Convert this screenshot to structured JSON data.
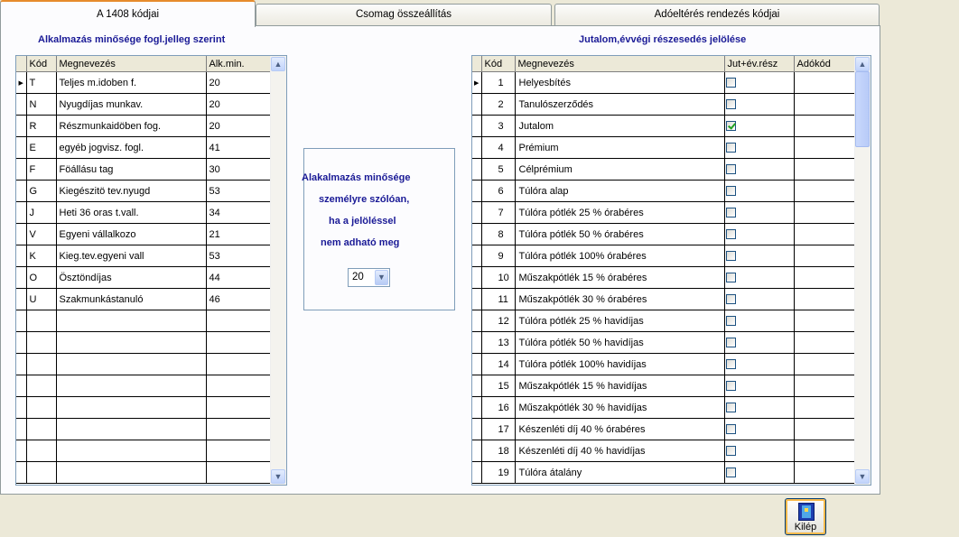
{
  "tabs": [
    {
      "label": "A 1408 kódjai"
    },
    {
      "label": "Csomag összeállítás"
    },
    {
      "label": "Adóeltérés rendezés kódjai"
    }
  ],
  "left": {
    "caption": "Alkalmazás minősége fogl.jelleg szerint",
    "columns": [
      "Kód",
      "Megnevezés",
      "Alk.min."
    ],
    "rows": [
      {
        "kod": "T",
        "name": "Teljes m.idoben f.",
        "alk": "20"
      },
      {
        "kod": "N",
        "name": "Nyugdíjas munkav.",
        "alk": "20"
      },
      {
        "kod": "R",
        "name": "Részmunkaidöben fog.",
        "alk": "20"
      },
      {
        "kod": "E",
        "name": "egyéb jogvisz. fogl.",
        "alk": "41"
      },
      {
        "kod": "F",
        "name": "Föállásu tag",
        "alk": "30"
      },
      {
        "kod": "G",
        "name": "Kiegészitö tev.nyugd",
        "alk": "53"
      },
      {
        "kod": "J",
        "name": "Heti 36 oras t.vall.",
        "alk": "34"
      },
      {
        "kod": "V",
        "name": "Egyeni vállalkozo",
        "alk": "21"
      },
      {
        "kod": "K",
        "name": "Kieg.tev.egyeni vall",
        "alk": "53"
      },
      {
        "kod": "O",
        "name": "Ösztöndíjas",
        "alk": "44"
      },
      {
        "kod": "U",
        "name": "Szakmunkástanuló",
        "alk": "46"
      }
    ]
  },
  "middle": {
    "lines": [
      "Alakalmazás minősége",
      "személyre szólóan,",
      "ha a jelöléssel",
      "nem adható meg"
    ],
    "combo_value": "20"
  },
  "right": {
    "caption": "Jutalom,évvégi részesedés jelölése",
    "columns": [
      "Kód",
      "Megnevezés",
      "Jut+év.rész",
      "Adókód"
    ],
    "rows": [
      {
        "kod": "1",
        "name": "Helyesbítés",
        "checked": false
      },
      {
        "kod": "2",
        "name": "Tanulószerződés",
        "checked": false
      },
      {
        "kod": "3",
        "name": "Jutalom",
        "checked": true
      },
      {
        "kod": "4",
        "name": "Prémium",
        "checked": false
      },
      {
        "kod": "5",
        "name": "Célprémium",
        "checked": false
      },
      {
        "kod": "6",
        "name": "Túlóra alap",
        "checked": false
      },
      {
        "kod": "7",
        "name": "Túlóra pótlék 25 % órabéres",
        "checked": false
      },
      {
        "kod": "8",
        "name": "Túlóra pótlék 50 % órabéres",
        "checked": false
      },
      {
        "kod": "9",
        "name": "Túlóra pótlék  100% órabéres",
        "checked": false
      },
      {
        "kod": "10",
        "name": "Műszakpótlék 15 % órabéres",
        "checked": false
      },
      {
        "kod": "11",
        "name": "Műszakpótlék 30 % órabéres",
        "checked": false
      },
      {
        "kod": "12",
        "name": "Túlóra pótlék 25 % havidíjas",
        "checked": false
      },
      {
        "kod": "13",
        "name": "Túlóra pótlék 50 % havidíjas",
        "checked": false
      },
      {
        "kod": "14",
        "name": "Túlóra pótlék 100% havidíjas",
        "checked": false
      },
      {
        "kod": "15",
        "name": "Műszakpótlék 15 % havidíjas",
        "checked": false
      },
      {
        "kod": "16",
        "name": "Műszakpótlék 30 % havidíjas",
        "checked": false
      },
      {
        "kod": "17",
        "name": "Készenléti díj 40 % órabéres",
        "checked": false
      },
      {
        "kod": "18",
        "name": "Készenléti díj 40 % havidíjas",
        "checked": false
      },
      {
        "kod": "19",
        "name": "Túlóra átalány",
        "checked": false
      }
    ]
  },
  "exit_button": {
    "label": "Kilép"
  }
}
